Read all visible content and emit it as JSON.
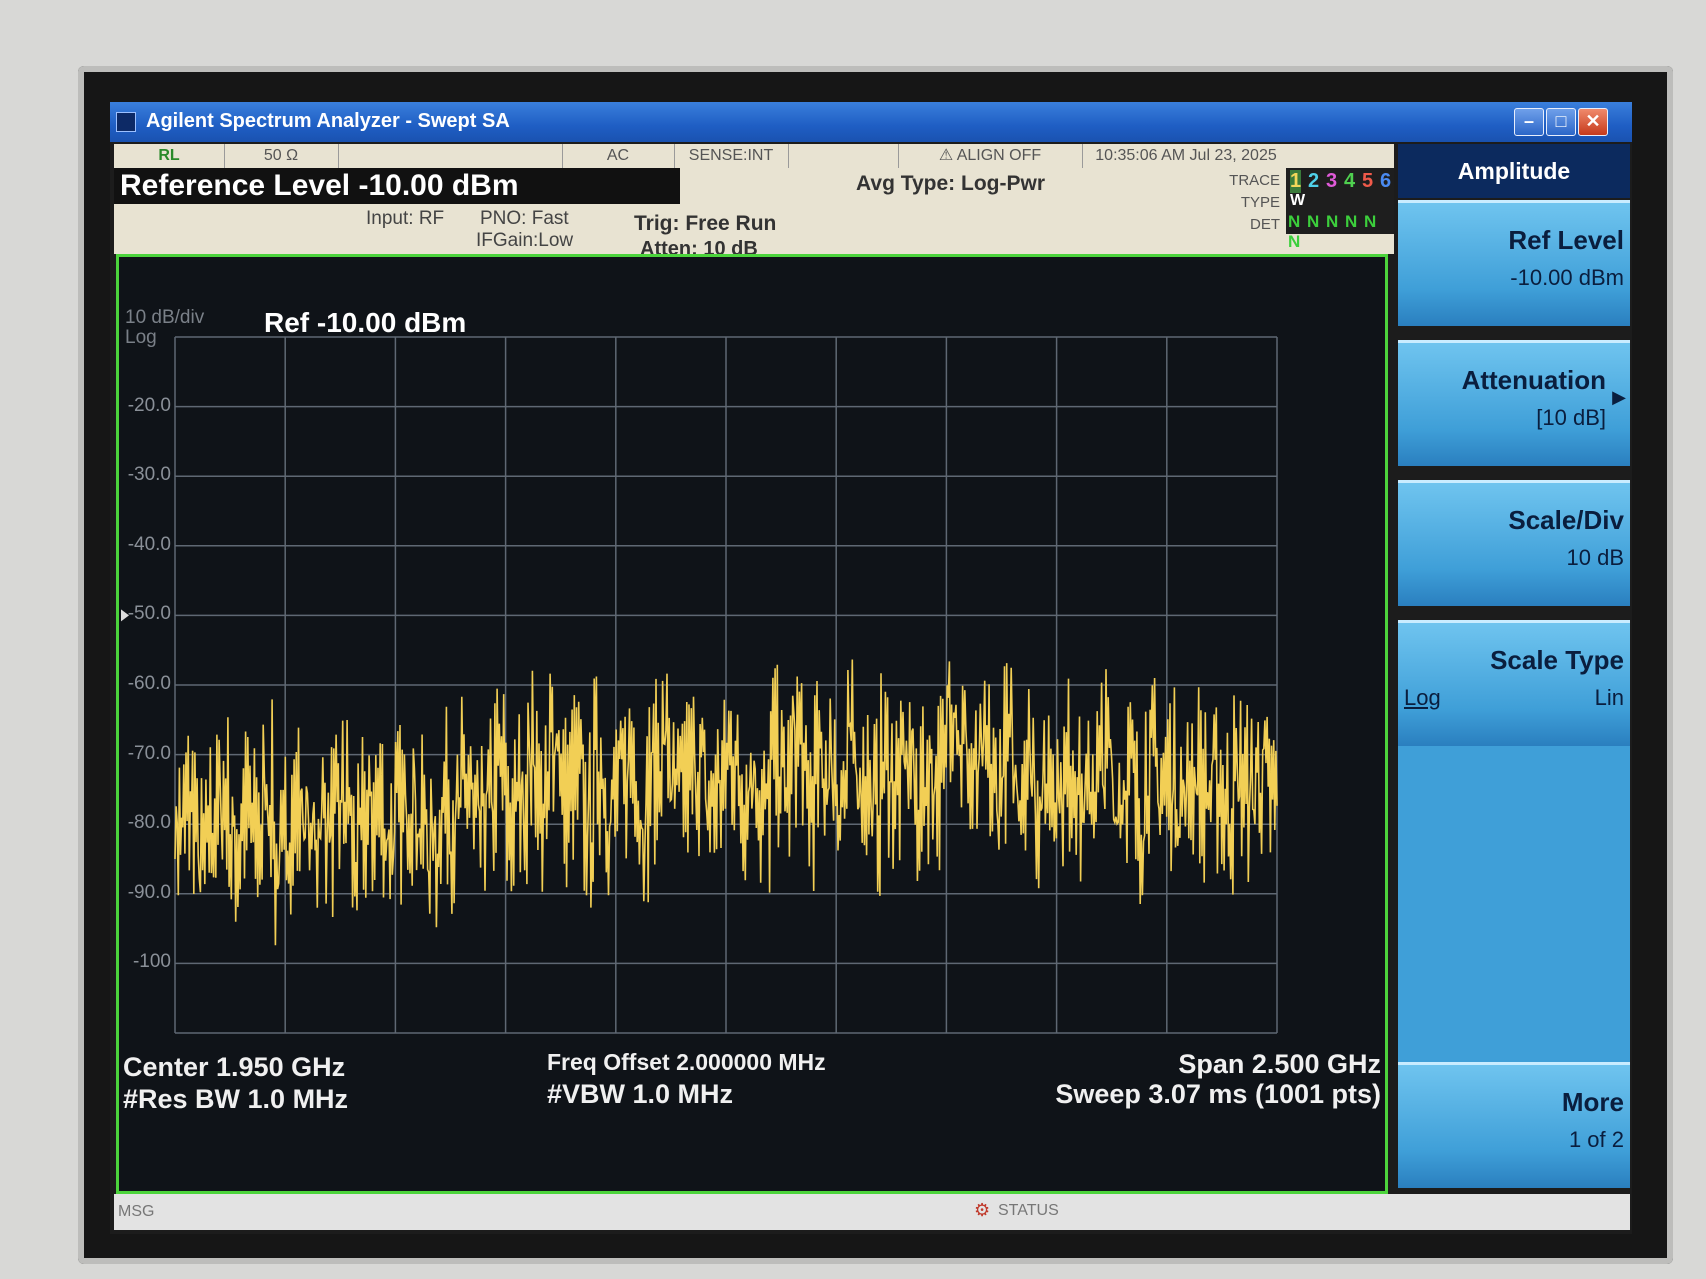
{
  "window": {
    "title": "Agilent Spectrum Analyzer - Swept SA"
  },
  "status_bar": {
    "logo": "RL",
    "impedance": "50 Ω",
    "coupling": "AC",
    "sense": "SENSE:INT",
    "align": "ALIGN OFF",
    "datetime": "10:35:06 AM Jul 23, 2025"
  },
  "info": {
    "reference_level": "Reference Level  -10.00 dBm",
    "input": "Input: RF",
    "pno": "PNO: Fast",
    "ifgain": "IFGain:Low",
    "trig": "Trig: Free Run",
    "atten": "Atten: 10 dB",
    "avg_type": "Avg Type: Log-Pwr",
    "trace_label": "TRACE",
    "type_label": "TYPE",
    "det_label": "DET",
    "trace_numbers": [
      "1",
      "2",
      "3",
      "4",
      "5",
      "6"
    ],
    "trace_colors": [
      "#f2d65a",
      "#4fd0e8",
      "#e05ad8",
      "#4fd04f",
      "#f05a4a",
      "#4a8af0"
    ],
    "type_value": "W",
    "det_values": "N N N N N N"
  },
  "plot": {
    "scale": "10 dB/div",
    "scale_type": "Log",
    "ref": "Ref -10.00 dBm",
    "y_ticks": [
      "-20.0",
      "-30.0",
      "-40.0",
      "-50.0",
      "-60.0",
      "-70.0",
      "-80.0",
      "-90.0",
      "-100"
    ],
    "trace_color": "#f2cf55",
    "grid_color": "#5f6873"
  },
  "footer": {
    "center": "Center 1.950 GHz",
    "rbw": "#Res BW 1.0 MHz",
    "freq_offset": "Freq Offset 2.000000 MHz",
    "vbw": "#VBW 1.0 MHz",
    "span": "Span 2.500 GHz",
    "sweep": "Sweep  3.07 ms (1001 pts)"
  },
  "msg_bar": {
    "msg": "MSG",
    "status": "STATUS"
  },
  "softkeys": {
    "menu_title": "Amplitude",
    "ref_level": {
      "label": "Ref Level",
      "value": "-10.00 dBm"
    },
    "attenuation": {
      "label": "Attenuation",
      "value": "[10 dB]"
    },
    "scale_div": {
      "label": "Scale/Div",
      "value": "10 dB"
    },
    "scale_type": {
      "label": "Scale Type",
      "opt_log": "Log",
      "opt_lin": "Lin"
    },
    "more": {
      "label": "More",
      "value": "1 of 2"
    }
  },
  "chart_data": {
    "type": "line",
    "title": "",
    "xlabel": "",
    "ylabel": "",
    "ylim": [
      -110,
      -10
    ],
    "x_center_ghz": 1.95,
    "x_span_ghz": 2.5,
    "x_range_ghz": [
      0.7,
      3.2
    ],
    "series": [
      {
        "values": [
          -80,
          -77,
          -85,
          -79,
          -76,
          -83,
          -78,
          -81,
          -75,
          -86,
          -79,
          -77,
          -82,
          -78,
          -80,
          -76,
          -84,
          -79,
          -77,
          -81,
          -78,
          -75,
          -80,
          -83,
          -76,
          -79,
          -74,
          -81,
          -77,
          -72,
          -79,
          -75,
          -70,
          -78,
          -66,
          -76,
          -73,
          -79,
          -71,
          -77,
          -74,
          -70,
          -78,
          -72,
          -68,
          -76,
          -73,
          -71,
          -77,
          -74,
          -69,
          -75,
          -72,
          -78,
          -70,
          -74,
          -67,
          -76,
          -72,
          -71,
          -75,
          -69,
          -73,
          -77,
          -71,
          -74,
          -70,
          -76,
          -72,
          -73,
          -60,
          -68,
          -74,
          -71,
          -75,
          -69,
          -73,
          -70,
          -76,
          -72,
          -74,
          -71,
          -77,
          -73,
          -70,
          -75,
          -72,
          -78,
          -71,
          -74,
          -73,
          -76,
          -72,
          -75,
          -74,
          -77,
          -73,
          -75,
          -72,
          -76
        ]
      }
    ]
  }
}
